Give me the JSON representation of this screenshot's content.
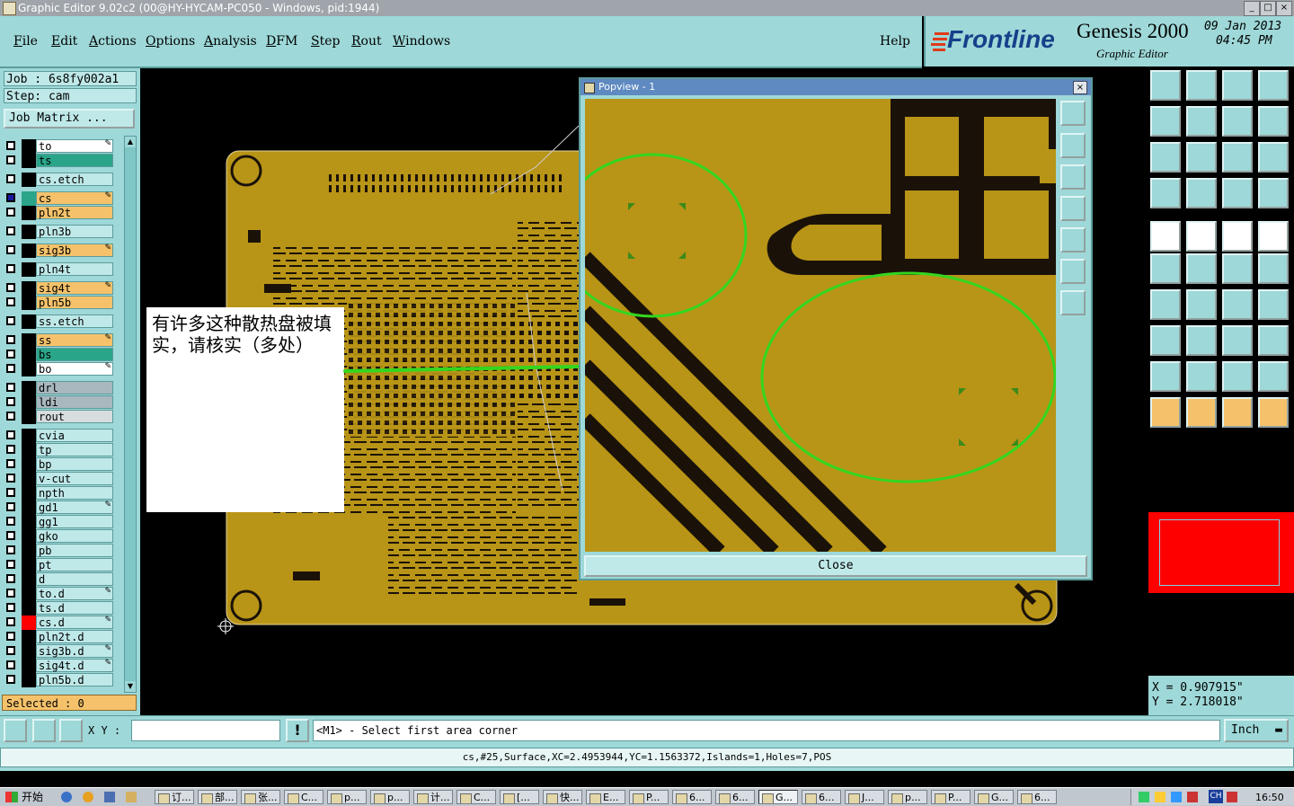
{
  "window": {
    "title": "Graphic Editor 9.02c2 (00@HY-HYCAM-PC050 - Windows, pid:1944)"
  },
  "menu": [
    {
      "label": "File",
      "key": "F",
      "rest": "ile"
    },
    {
      "label": "Edit",
      "key": "E",
      "rest": "dit"
    },
    {
      "label": "Actions",
      "key": "A",
      "rest": "ctions"
    },
    {
      "label": "Options",
      "key": "O",
      "rest": "ptions"
    },
    {
      "label": "Analysis",
      "key": "A",
      "rest": "nalysis"
    },
    {
      "label": "DFM",
      "key": "D",
      "rest": "FM"
    },
    {
      "label": "Step",
      "key": "S",
      "rest": "tep"
    },
    {
      "label": "Rout",
      "key": "R",
      "rest": "out"
    },
    {
      "label": "Windows",
      "key": "W",
      "rest": "indows"
    }
  ],
  "help_label": "Help",
  "brand": {
    "logo": "Frontline",
    "product": "Genesis 2000",
    "subtitle": "Graphic Editor",
    "date": "09 Jan 2013",
    "time": "04:45 PM"
  },
  "job": {
    "job_label": "Job : 6s8fy002a1",
    "step_label": "Step: cam",
    "matrix_button": "Job Matrix ..."
  },
  "layers": [
    {
      "name": "to",
      "color": "#ffffff",
      "editable": true
    },
    {
      "name": "ts",
      "color": "#2aa589",
      "editable": false
    },
    {
      "name": "cs.etch",
      "color": "#bfe8e8",
      "editable": false
    },
    {
      "name": "cs",
      "color": "#f5c26b",
      "editable": true,
      "work": true
    },
    {
      "name": "pln2t",
      "color": "#f5c26b",
      "editable": false
    },
    {
      "name": "pln3b",
      "color": "#bfe8e8",
      "editable": false
    },
    {
      "name": "sig3b",
      "color": "#f5c26b",
      "editable": true
    },
    {
      "name": "pln4t",
      "color": "#bfe8e8",
      "editable": false
    },
    {
      "name": "sig4t",
      "color": "#f5c26b",
      "editable": true
    },
    {
      "name": "pln5b",
      "color": "#f5c26b",
      "editable": false
    },
    {
      "name": "ss.etch",
      "color": "#bfe8e8",
      "editable": false
    },
    {
      "name": "ss",
      "color": "#f5c26b",
      "editable": true
    },
    {
      "name": "bs",
      "color": "#2aa589",
      "editable": false
    },
    {
      "name": "bo",
      "color": "#ffffff",
      "editable": true
    },
    {
      "name": "drl",
      "color": "#a9b7bf",
      "editable": false
    },
    {
      "name": "ldi",
      "color": "#a9b7bf",
      "editable": false
    },
    {
      "name": "rout",
      "color": "#d7dcdf",
      "editable": false
    },
    {
      "name": "cvia",
      "color": "#bfe8e8",
      "editable": false
    },
    {
      "name": "tp",
      "color": "#bfe8e8",
      "editable": false
    },
    {
      "name": "bp",
      "color": "#bfe8e8",
      "editable": false
    },
    {
      "name": "v-cut",
      "color": "#bfe8e8",
      "editable": false
    },
    {
      "name": "npth",
      "color": "#bfe8e8",
      "editable": false
    },
    {
      "name": "gd1",
      "color": "#bfe8e8",
      "editable": true
    },
    {
      "name": "gg1",
      "color": "#bfe8e8",
      "editable": false
    },
    {
      "name": "gko",
      "color": "#bfe8e8",
      "editable": false
    },
    {
      "name": "pb",
      "color": "#bfe8e8",
      "editable": false
    },
    {
      "name": "pt",
      "color": "#bfe8e8",
      "editable": false
    },
    {
      "name": "d",
      "color": "#bfe8e8",
      "editable": false
    },
    {
      "name": "to.d",
      "color": "#bfe8e8",
      "editable": true
    },
    {
      "name": "ts.d",
      "color": "#bfe8e8",
      "editable": false
    },
    {
      "name": "cs.d",
      "color": "#bfe8e8",
      "editable": true,
      "red": true
    },
    {
      "name": "pln2t.d",
      "color": "#bfe8e8",
      "editable": false
    },
    {
      "name": "sig3b.d",
      "color": "#bfe8e8",
      "editable": true
    },
    {
      "name": "sig4t.d",
      "color": "#bfe8e8",
      "editable": true
    },
    {
      "name": "pln5b.d",
      "color": "#bfe8e8",
      "editable": false
    }
  ],
  "selected_label": "Selected : 0",
  "annotation": {
    "text": "有许多这种散热盘被填实，请核实（多处）"
  },
  "popview": {
    "title": "Popview - 1",
    "close_label": "Close",
    "close_x": "×"
  },
  "coords": {
    "x": "X = 0.907915\"",
    "y": "Y = 2.718018\""
  },
  "cmd": {
    "xy_label": "X Y :",
    "xy_value": "",
    "prompt": "<M1> - Select first area corner",
    "unit": "Inch"
  },
  "status": {
    "text": "cs,#25,Surface,XC=2.4953944,YC=1.1563372,Islands=1,Holes=7,POS"
  },
  "taskbar": {
    "start": "开始",
    "tasks": [
      "订...",
      "部...",
      "张...",
      "C...",
      "p...",
      "p...",
      "计...",
      "C...",
      "[...",
      "快...",
      "E...",
      "P...",
      "6...",
      "6...",
      "G...",
      "6...",
      "J...",
      "p...",
      "P...",
      "G...",
      "6..."
    ],
    "clock": "16:50",
    "lang": "CH"
  },
  "colors": {
    "board": "#b89417",
    "accent": "#9ed8d8",
    "highlight": "#33d61f"
  }
}
